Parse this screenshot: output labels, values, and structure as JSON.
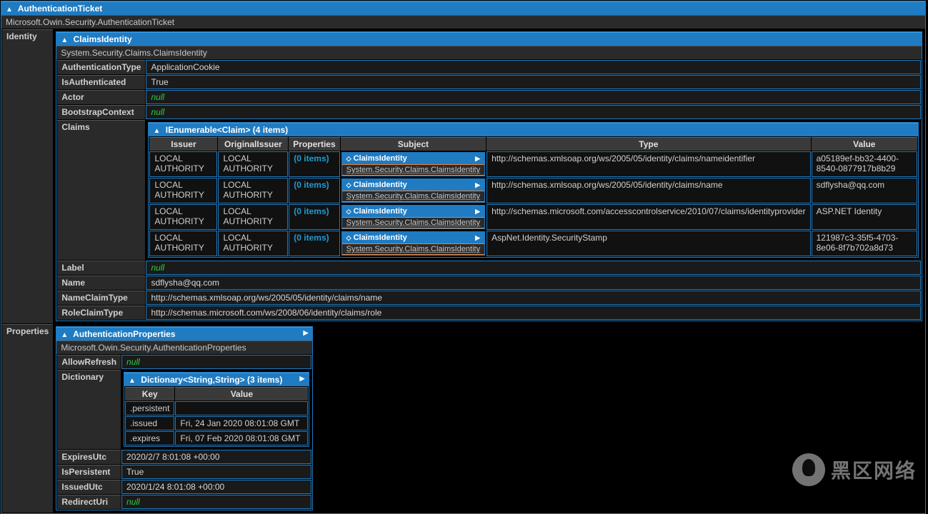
{
  "root": {
    "title": "AuthenticationTicket",
    "type": "Microsoft.Owin.Security.AuthenticationTicket"
  },
  "identity_label": "Identity",
  "claimsIdentity": {
    "title": "ClaimsIdentity",
    "type": "System.Security.Claims.ClaimsIdentity",
    "rows": {
      "authType_l": "AuthenticationType",
      "authType_v": "ApplicationCookie",
      "isAuth_l": "IsAuthenticated",
      "isAuth_v": "True",
      "actor_l": "Actor",
      "actor_v": "null",
      "boot_l": "BootstrapContext",
      "boot_v": "null",
      "claims_l": "Claims",
      "label_l": "Label",
      "label_v": "null",
      "name_l": "Name",
      "name_v": "sdflysha@qq.com",
      "nct_l": "NameClaimType",
      "nct_v": "http://schemas.xmlsoap.org/ws/2005/05/identity/claims/name",
      "rct_l": "RoleClaimType",
      "rct_v": "http://schemas.microsoft.com/ws/2008/06/identity/claims/role"
    }
  },
  "claimsTable": {
    "title": "IEnumerable<Claim> (4 items)",
    "headers": {
      "issuer": "Issuer",
      "origIssuer": "OriginalIssuer",
      "props": "Properties",
      "subject": "Subject",
      "type": "Type",
      "value": "Value"
    },
    "propItems": "(0 items)",
    "subjTitle": "ClaimsIdentity",
    "subjType": "System.Security.Claims.ClaimsIdentity",
    "rows": [
      {
        "issuer": "LOCAL AUTHORITY",
        "orig": "LOCAL AUTHORITY",
        "type": "http://schemas.xmlsoap.org/ws/2005/05/identity/claims/nameidentifier",
        "value": "a05189ef-bb32-4400-8540-0877917b8b29"
      },
      {
        "issuer": "LOCAL AUTHORITY",
        "orig": "LOCAL AUTHORITY",
        "type": "http://schemas.xmlsoap.org/ws/2005/05/identity/claims/name",
        "value": "sdflysha@qq.com"
      },
      {
        "issuer": "LOCAL AUTHORITY",
        "orig": "LOCAL AUTHORITY",
        "type": "http://schemas.microsoft.com/accesscontrolservice/2010/07/claims/identityprovider",
        "value": "ASP.NET Identity"
      },
      {
        "issuer": "LOCAL AUTHORITY",
        "orig": "LOCAL AUTHORITY",
        "type": "AspNet.Identity.SecurityStamp",
        "value": "121987c3-35f5-4703-8e06-8f7b702a8d73"
      }
    ]
  },
  "properties_label": "Properties",
  "authProps": {
    "title": "AuthenticationProperties",
    "type": "Microsoft.Owin.Security.AuthenticationProperties",
    "rows": {
      "allow_l": "AllowRefresh",
      "allow_v": "null",
      "dict_l": "Dictionary",
      "exp_l": "ExpiresUtc",
      "exp_v": "2020/2/7 8:01:08 +00:00",
      "isp_l": "IsPersistent",
      "isp_v": "True",
      "iss_l": "IssuedUtc",
      "iss_v": "2020/1/24 8:01:08 +00:00",
      "red_l": "RedirectUri",
      "red_v": "null"
    }
  },
  "dict": {
    "title": "Dictionary<String,String> (3 items)",
    "keyH": "Key",
    "valH": "Value",
    "rows": [
      {
        "k": ".persistent",
        "v": ""
      },
      {
        "k": ".issued",
        "v": "Fri, 24 Jan 2020 08:01:08 GMT"
      },
      {
        "k": ".expires",
        "v": "Fri, 07 Feb 2020 08:01:08 GMT"
      }
    ]
  },
  "watermark": "黑区网络"
}
